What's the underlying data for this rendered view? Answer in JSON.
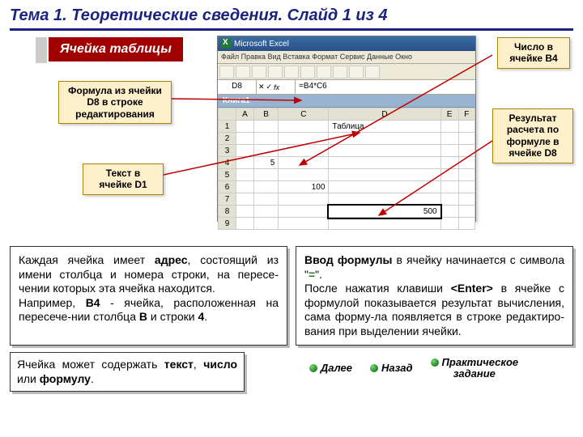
{
  "title": "Тема 1. Теоретические сведения. Слайд 1 из 4",
  "cell_label": "Ячейка таблицы",
  "callouts": {
    "formula": "Формула из ячейки D8 в строке редактирования",
    "text": "Текст в ячейке D1",
    "number": "Число в ячейке B4",
    "result": "Результат расчета по формуле в ячейке D8"
  },
  "excel": {
    "title": "Microsoft Excel",
    "menu": "Файл  Правка  Вид  Вставка  Формат  Сервис  Данные  Окно",
    "cellref": "D8",
    "formula": "=B4*C6",
    "book": "Книга1",
    "cols": [
      "",
      "A",
      "B",
      "C",
      "D",
      "E",
      "F"
    ],
    "d1": "Таблица",
    "b4": "5",
    "c6": "100",
    "d8": "500"
  },
  "text_left": {
    "p1a": "Каждая ячейка имеет ",
    "p1b": "адрес",
    "p1c": ", состоящий из имени столбца и номера строки, на пересе-чении которых эта ячейка находится.",
    "p2a": "Например, ",
    "p2b": "B4",
    "p2c": " - ячейка, расположенная на пересече-нии столбца ",
    "p2d": "B",
    "p2e": " и строки ",
    "p2f": "4",
    "p2g": "."
  },
  "text_right": {
    "p1a": "Ввод формулы",
    "p1b": " в ячейку начинается с символа \"",
    "p1c": "=",
    "p1d": "\".",
    "p2a": "После нажатия клавиши ",
    "p2b": "<Enter>",
    "p2c": " в ячейке с формулой показывается результат вычисления, сама форму-ла появляется в строке редактиро-вания при выделении ячейки."
  },
  "text_small": {
    "a": "Ячейка может содержать ",
    "b": "текст",
    "c": ", ",
    "d": "число",
    "e": " или ",
    "f": "формулу",
    "g": "."
  },
  "nav": {
    "next": "Далее",
    "back": "Назад",
    "task1": "Практическое",
    "task2": "задание"
  }
}
